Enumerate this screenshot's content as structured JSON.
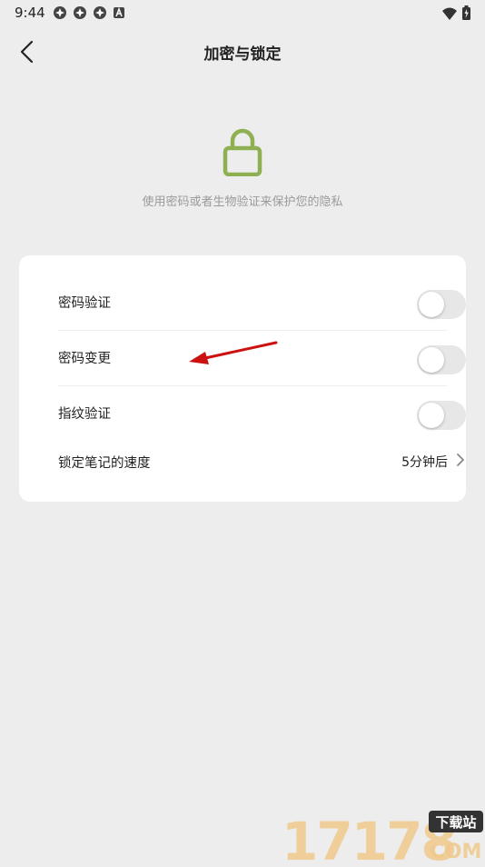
{
  "status_bar": {
    "time": "9:44",
    "left_icons": [
      "notification-icon",
      "notification-icon",
      "notification-icon",
      "a-box-icon"
    ],
    "right_icons": [
      "wifi-icon",
      "battery-icon"
    ]
  },
  "header": {
    "title": "加密与锁定",
    "back_icon": "chevron-left-icon"
  },
  "intro": {
    "icon": "lock-icon",
    "icon_color": "#8fb052",
    "text": "使用密码或者生物验证来保护您的隐私"
  },
  "settings": {
    "rows": [
      {
        "label": "密码验证",
        "type": "toggle",
        "on": false
      },
      {
        "label": "密码变更",
        "type": "toggle",
        "on": false
      },
      {
        "label": "指纹验证",
        "type": "toggle",
        "on": false
      },
      {
        "label": "锁定笔记的速度",
        "type": "value",
        "value": "5分钟后"
      }
    ]
  },
  "annotation": {
    "color": "#cc1111"
  },
  "watermark": {
    "text": "17178",
    "badge": "下载站",
    "domain": "COM"
  }
}
